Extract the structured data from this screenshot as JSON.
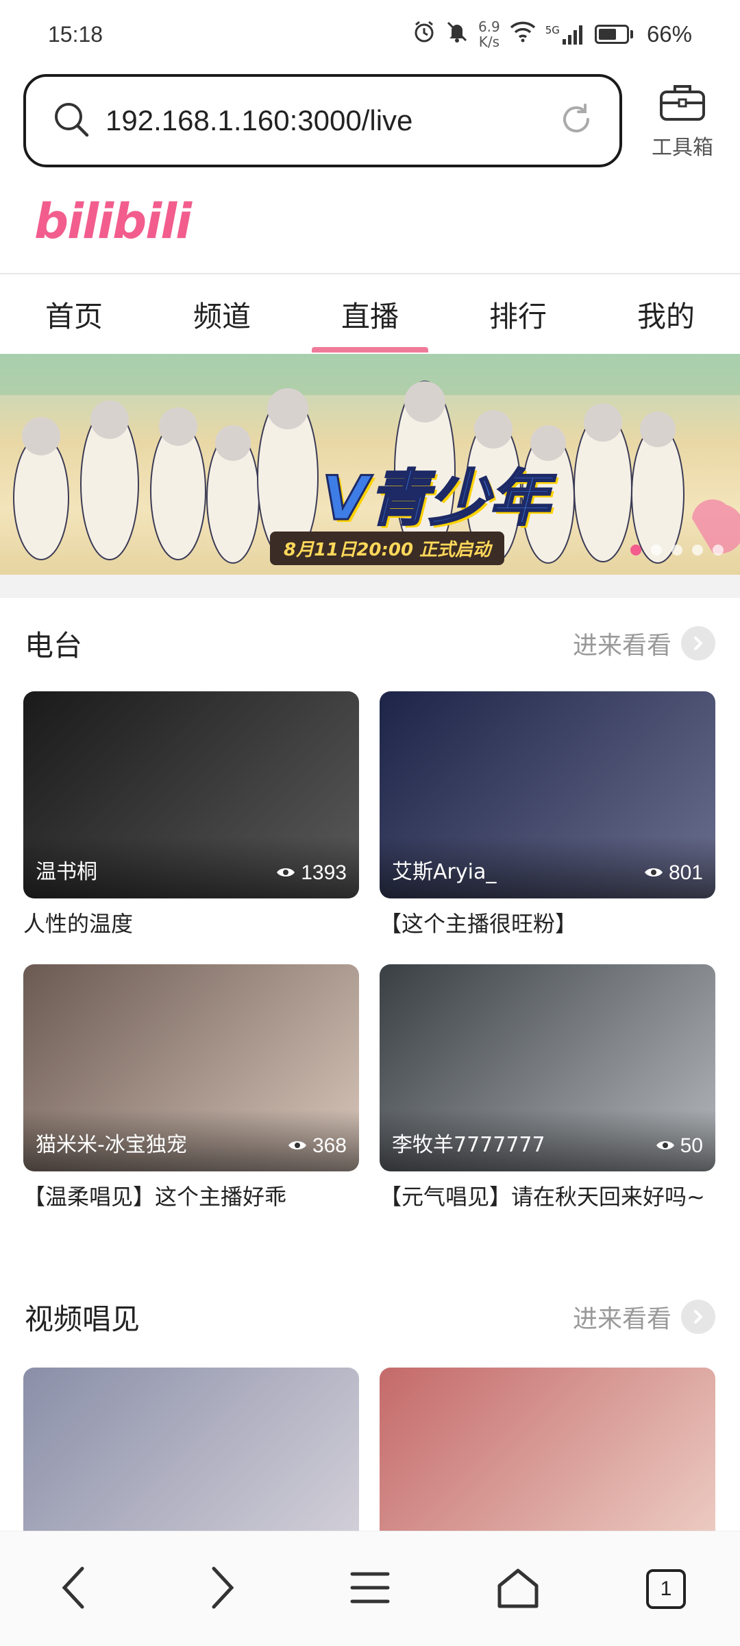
{
  "status_bar": {
    "time": "15:18",
    "net_speed_value": "6.9",
    "net_speed_unit": "K/s",
    "signal_label": "5G",
    "battery_percent": "66%",
    "battery_level": 0.66
  },
  "browser": {
    "url": "192.168.1.160:3000/live",
    "toolbox_label": "工具箱"
  },
  "site": {
    "logo_text": "bilibili"
  },
  "tabs": [
    {
      "label": "首页",
      "active": false
    },
    {
      "label": "频道",
      "active": false
    },
    {
      "label": "直播",
      "active": true
    },
    {
      "label": "排行",
      "active": false
    },
    {
      "label": "我的",
      "active": false
    }
  ],
  "banner": {
    "title": "V青少年",
    "caption": "8月11日20:00 正式启动",
    "slide_count": 5,
    "active_slide": 0
  },
  "radio_section": {
    "title": "电台",
    "more_label": "进来看看",
    "cards": [
      {
        "streamer": "温书桐",
        "views": "1393",
        "title": "人性的温度",
        "color_a": "#1a1a1a",
        "color_b": "#5a5a5a"
      },
      {
        "streamer": "艾斯Aryia_",
        "views": "801",
        "title": "【这个主播很旺粉】",
        "color_a": "#1d2447",
        "color_b": "#6b6f8f"
      },
      {
        "streamer": "猫米米-冰宝独宠",
        "views": "368",
        "title": "【温柔唱见】这个主播好乖",
        "color_a": "#6b5a52",
        "color_b": "#d9c7bb"
      },
      {
        "streamer": "李牧羊7777777",
        "views": "50",
        "title": "【元气唱见】请在秋天回来好吗~",
        "color_a": "#3a3f44",
        "color_b": "#b5b9bd"
      }
    ]
  },
  "video_section": {
    "title": "视频唱见",
    "more_label": "进来看看",
    "cards": [
      {
        "color_a": "#8a8fa8",
        "color_b": "#d8d4dc"
      },
      {
        "color_a": "#c46a6a",
        "color_b": "#efd3c9"
      }
    ]
  },
  "bottom_nav": {
    "tab_count": "1"
  }
}
